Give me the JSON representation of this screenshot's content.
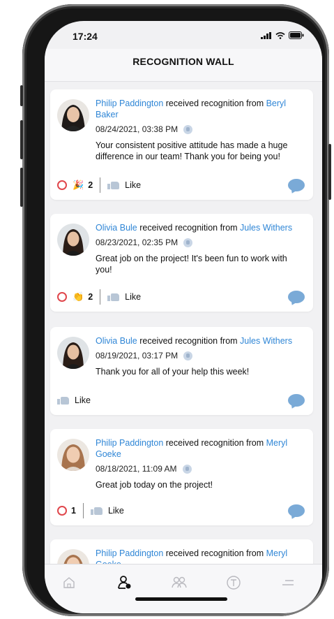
{
  "status_bar": {
    "time": "17:24"
  },
  "header": {
    "title": "RECOGNITION WALL"
  },
  "posts": [
    {
      "recipient": "Philip Paddington",
      "verb": " received recognition from ",
      "giver": "Beryl Baker",
      "date": "08/24/2021, 03:38 PM",
      "message": "Your consistent positive attitude has made a huge difference in our team! Thank you for being you!",
      "reactions": {
        "emoji": "🎉",
        "count": "2"
      },
      "like_label": "Like"
    },
    {
      "recipient": "Olivia Bule",
      "verb": " received recognition from ",
      "giver": "Jules Withers",
      "date": "08/23/2021, 02:35 PM",
      "message": "Great job on the project! It's been fun to work with you!",
      "reactions": {
        "emoji": "👏",
        "count": "2"
      },
      "like_label": "Like"
    },
    {
      "recipient": "Olivia Bule",
      "verb": " received recognition from ",
      "giver": "Jules Withers",
      "date": "08/19/2021, 03:17 PM",
      "message": "Thank you for all of your help this week!",
      "like_label": "Like"
    },
    {
      "recipient": "Philip Paddington",
      "verb": " received recognition from ",
      "giver": "Meryl Goeke",
      "date": "08/18/2021, 11:09 AM",
      "message": "Great job today on the project!",
      "reactions": {
        "count": "1"
      },
      "like_label": "Like"
    },
    {
      "recipient": "Philip Paddington",
      "verb": " received recognition from ",
      "giver": "Meryl Goeke"
    }
  ],
  "tabbar": {
    "items": [
      "home-icon",
      "recognition-icon",
      "people-icon",
      "trophy-icon",
      "menu-icon"
    ],
    "active": "recognition-icon"
  },
  "colors": {
    "name_link": "#2f86d6",
    "heart": "#e0474c",
    "comment": "#7aaad7"
  }
}
